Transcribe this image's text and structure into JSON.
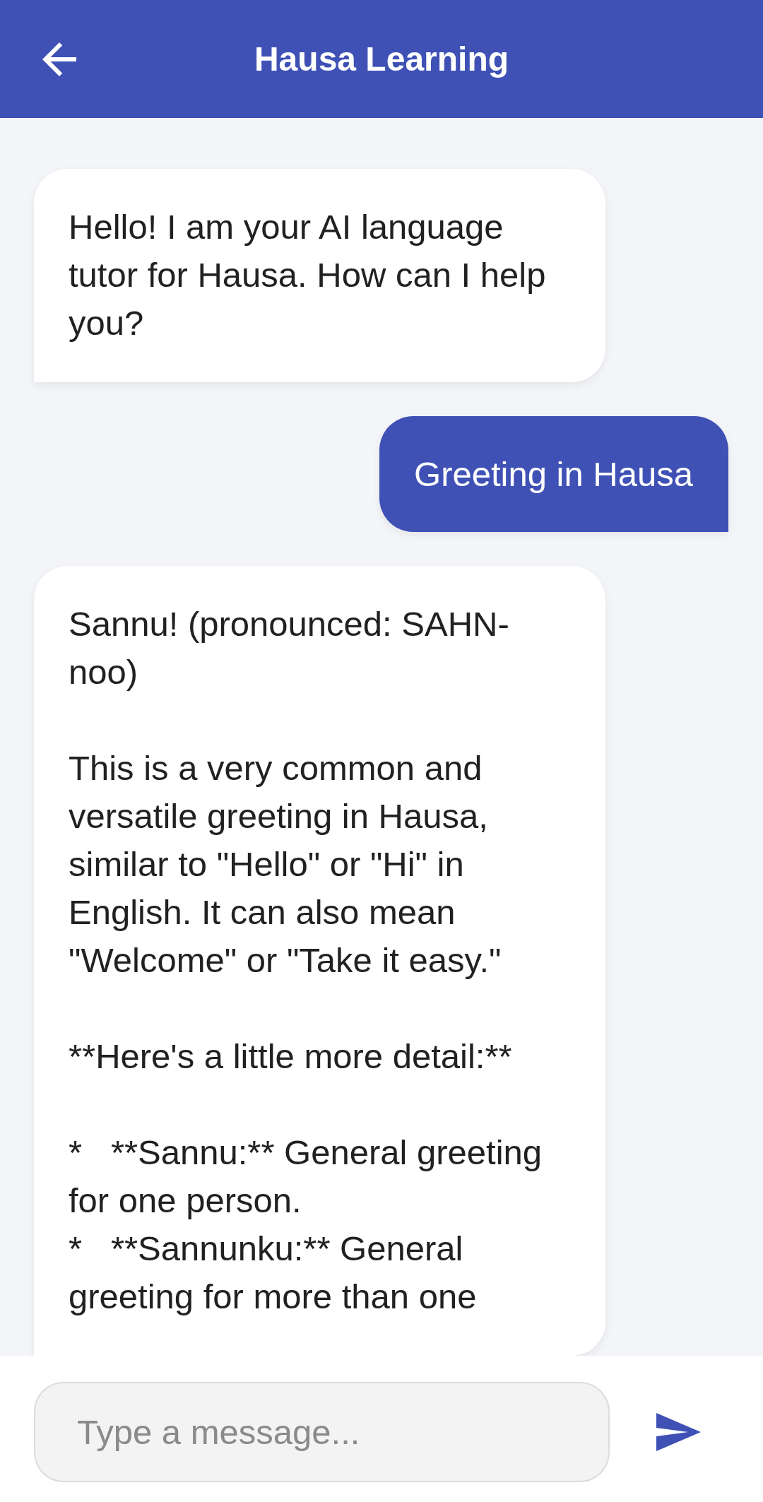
{
  "app_bar": {
    "title": "Hausa Learning"
  },
  "messages": [
    {
      "kind": "incoming",
      "text": "Hello! I am your AI language tutor for Hausa. How can I help you?"
    },
    {
      "kind": "outgoing",
      "text": "Greeting in Hausa"
    },
    {
      "kind": "incoming",
      "text": "Sannu! (pronounced: SAHN-noo)\n\nThis is a very common and versatile greeting in Hausa, similar to \"Hello\" or \"Hi\" in English. It can also mean \"Welcome\" or \"Take it easy.\"\n\n**Here's a little more detail:**\n\n*   **Sannu:** General greeting for one person.\n*   **Sannunku:** General greeting for more than one"
    }
  ],
  "composer": {
    "placeholder": "Type a message..."
  }
}
